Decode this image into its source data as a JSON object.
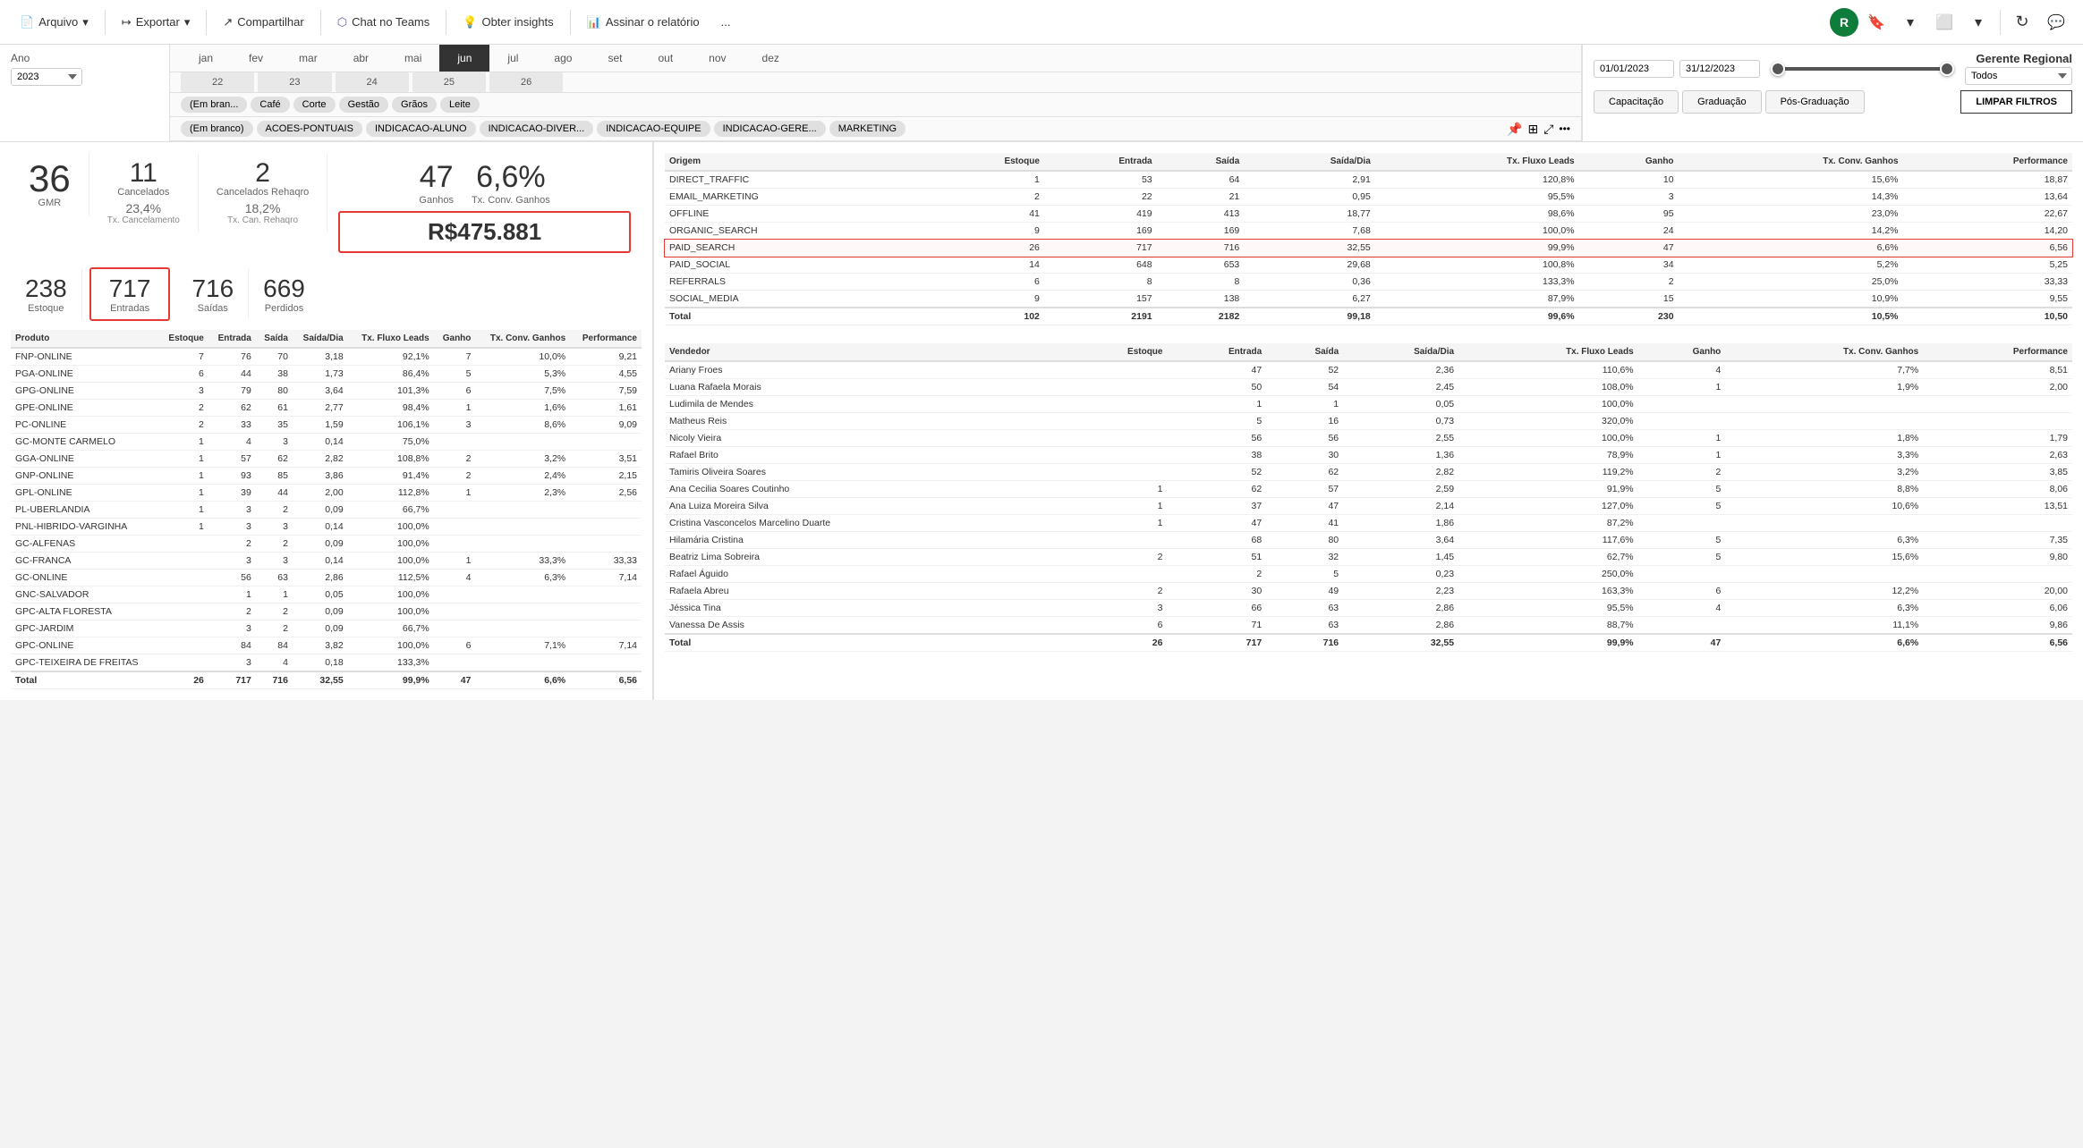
{
  "toolbar": {
    "arquivo_label": "Arquivo",
    "exportar_label": "Exportar",
    "compartilhar_label": "Compartilhar",
    "chat_label": "Chat no Teams",
    "insights_label": "Obter insights",
    "assinar_label": "Assinar o relatório",
    "more_label": "..."
  },
  "header": {
    "year_label": "Ano",
    "year_value": "2023",
    "date_start": "01/01/2023",
    "date_end": "31/12/2023",
    "regional_label": "Gerente Regional",
    "regional_value": "Todos"
  },
  "months": [
    "jan",
    "fev",
    "mar",
    "abr",
    "mai",
    "jun",
    "jul",
    "ago",
    "set",
    "out",
    "nov",
    "dez"
  ],
  "active_month": "jun",
  "weeks": [
    "22",
    "23",
    "24",
    "25",
    "26"
  ],
  "categories": [
    "(Em bran...",
    "Café",
    "Corte",
    "Gestão",
    "Grãos",
    "Leite"
  ],
  "subcategories": [
    "(Em branco)",
    "ACOES-PONTUAIS",
    "INDICACAO-ALUNO",
    "INDICACAO-DIVER...",
    "INDICACAO-EQUIPE",
    "INDICACAO-GERE...",
    "MARKETING"
  ],
  "education_tabs": [
    "Capacitação",
    "Graduação",
    "Pós-Graduação"
  ],
  "clear_btn": "LIMPAR FILTROS",
  "kpis": {
    "gmr_value": "36",
    "gmr_label": "GMR",
    "cancelados_value": "11",
    "cancelados_label": "Cancelados",
    "cancelados_rehaqro_value": "2",
    "cancelados_rehaqro_label": "Cancelados Rehaqro",
    "estoque_value": "238",
    "estoque_label": "Estoque",
    "tx_cancelamento_value": "23,4%",
    "tx_cancelamento_label": "Tx. Cancelamento",
    "tx_can_rehaqro_value": "18,2%",
    "tx_can_rehaqro_label": "Tx. Can. Rehaqro",
    "entradas_value": "717",
    "entradas_label": "Entradas",
    "saidas_value": "716",
    "saidas_label": "Saídas",
    "perdidos_value": "669",
    "perdidos_label": "Perdidos",
    "ganhos_value": "47",
    "ganhos_label": "Ganhos",
    "tx_conv_value": "6,6%",
    "tx_conv_label": "Tx. Conv. Ganhos",
    "revenue_value": "R$475.881"
  },
  "product_table": {
    "columns": [
      "Produto",
      "Estoque",
      "Entrada",
      "Saída",
      "Saída/Dia",
      "Tx. Fluxo Leads",
      "Ganho",
      "Tx. Conv. Ganhos",
      "Performance"
    ],
    "rows": [
      [
        "FNP-ONLINE",
        "7",
        "76",
        "70",
        "3,18",
        "92,1%",
        "7",
        "10,0%",
        "9,21"
      ],
      [
        "PGA-ONLINE",
        "6",
        "44",
        "38",
        "1,73",
        "86,4%",
        "5",
        "5,3%",
        "4,55"
      ],
      [
        "GPG-ONLINE",
        "3",
        "79",
        "80",
        "3,64",
        "101,3%",
        "6",
        "7,5%",
        "7,59"
      ],
      [
        "GPE-ONLINE",
        "2",
        "62",
        "61",
        "2,77",
        "98,4%",
        "1",
        "1,6%",
        "1,61"
      ],
      [
        "PC-ONLINE",
        "2",
        "33",
        "35",
        "1,59",
        "106,1%",
        "3",
        "8,6%",
        "9,09"
      ],
      [
        "GC-MONTE CARMELO",
        "1",
        "4",
        "3",
        "0,14",
        "75,0%",
        "",
        "",
        ""
      ],
      [
        "GGA-ONLINE",
        "1",
        "57",
        "62",
        "2,82",
        "108,8%",
        "2",
        "3,2%",
        "3,51"
      ],
      [
        "GNP-ONLINE",
        "1",
        "93",
        "85",
        "3,86",
        "91,4%",
        "2",
        "2,4%",
        "2,15"
      ],
      [
        "GPL-ONLINE",
        "1",
        "39",
        "44",
        "2,00",
        "112,8%",
        "1",
        "2,3%",
        "2,56"
      ],
      [
        "PL-UBERLANDIA",
        "1",
        "3",
        "2",
        "0,09",
        "66,7%",
        "",
        "",
        ""
      ],
      [
        "PNL-HIBRIDO-VARGINHA",
        "1",
        "3",
        "3",
        "0,14",
        "100,0%",
        "",
        "",
        ""
      ],
      [
        "GC-ALFENAS",
        "",
        "2",
        "2",
        "0,09",
        "100,0%",
        "",
        "",
        ""
      ],
      [
        "GC-FRANCA",
        "",
        "3",
        "3",
        "0,14",
        "100,0%",
        "1",
        "33,3%",
        "33,33"
      ],
      [
        "GC-ONLINE",
        "",
        "56",
        "63",
        "2,86",
        "112,5%",
        "4",
        "6,3%",
        "7,14"
      ],
      [
        "GNC-SALVADOR",
        "",
        "1",
        "1",
        "0,05",
        "100,0%",
        "",
        "",
        ""
      ],
      [
        "GPC-ALTA FLORESTA",
        "",
        "2",
        "2",
        "0,09",
        "100,0%",
        "",
        "",
        ""
      ],
      [
        "GPC-JARDIM",
        "",
        "3",
        "2",
        "0,09",
        "66,7%",
        "",
        "",
        ""
      ],
      [
        "GPC-ONLINE",
        "",
        "84",
        "84",
        "3,82",
        "100,0%",
        "6",
        "7,1%",
        "7,14"
      ],
      [
        "GPC-TEIXEIRA DE FREITAS",
        "",
        "3",
        "4",
        "0,18",
        "133,3%",
        "",
        "",
        ""
      ]
    ],
    "total": [
      "Total",
      "26",
      "717",
      "716",
      "32,55",
      "99,9%",
      "47",
      "6,6%",
      "6,56"
    ]
  },
  "origem_table": {
    "columns": [
      "Origem",
      "Estoque",
      "Entrada",
      "Saída",
      "Saída/Dia",
      "Tx. Fluxo Leads",
      "Ganho",
      "Tx. Conv. Ganhos",
      "Performance"
    ],
    "rows": [
      [
        "DIRECT_TRAFFIC",
        "1",
        "53",
        "64",
        "2,91",
        "120,8%",
        "10",
        "15,6%",
        "18,87"
      ],
      [
        "EMAIL_MARKETING",
        "2",
        "22",
        "21",
        "0,95",
        "95,5%",
        "3",
        "14,3%",
        "13,64"
      ],
      [
        "OFFLINE",
        "41",
        "419",
        "413",
        "18,77",
        "98,6%",
        "95",
        "23,0%",
        "22,67"
      ],
      [
        "ORGANIC_SEARCH",
        "9",
        "169",
        "169",
        "7,68",
        "100,0%",
        "24",
        "14,2%",
        "14,20"
      ],
      [
        "PAID_SEARCH",
        "26",
        "717",
        "716",
        "32,55",
        "99,9%",
        "47",
        "6,6%",
        "6,56"
      ],
      [
        "PAID_SOCIAL",
        "14",
        "648",
        "653",
        "29,68",
        "100,8%",
        "34",
        "5,2%",
        "5,25"
      ],
      [
        "REFERRALS",
        "6",
        "8",
        "8",
        "0,36",
        "133,3%",
        "2",
        "25,0%",
        "33,33"
      ],
      [
        "SOCIAL_MEDIA",
        "9",
        "157",
        "138",
        "6,27",
        "87,9%",
        "15",
        "10,9%",
        "9,55"
      ]
    ],
    "total": [
      "Total",
      "102",
      "2191",
      "2182",
      "99,18",
      "99,6%",
      "230",
      "10,5%",
      "10,50"
    ]
  },
  "vendedor_table": {
    "columns": [
      "Vendedor",
      "Estoque",
      "Entrada",
      "Saída",
      "Saída/Dia",
      "Tx. Fluxo Leads",
      "Ganho",
      "Tx. Conv. Ganhos",
      "Performance"
    ],
    "rows": [
      [
        "Ariany Froes",
        "",
        "47",
        "52",
        "2,36",
        "110,6%",
        "4",
        "7,7%",
        "8,51"
      ],
      [
        "Luana Rafaela Morais",
        "",
        "50",
        "54",
        "2,45",
        "108,0%",
        "1",
        "1,9%",
        "2,00"
      ],
      [
        "Ludimila de Mendes",
        "",
        "1",
        "1",
        "0,05",
        "100,0%",
        "",
        "",
        ""
      ],
      [
        "Matheus Reis",
        "",
        "5",
        "16",
        "0,73",
        "320,0%",
        "",
        "",
        ""
      ],
      [
        "Nicoly Vieira",
        "",
        "56",
        "56",
        "2,55",
        "100,0%",
        "1",
        "1,8%",
        "1,79"
      ],
      [
        "Rafael Brito",
        "",
        "38",
        "30",
        "1,36",
        "78,9%",
        "1",
        "3,3%",
        "2,63"
      ],
      [
        "Tamiris Oliveira Soares",
        "",
        "52",
        "62",
        "2,82",
        "119,2%",
        "2",
        "3,2%",
        "3,85"
      ],
      [
        "Ana Cecilia Soares Coutinho",
        "1",
        "62",
        "57",
        "2,59",
        "91,9%",
        "5",
        "8,8%",
        "8,06"
      ],
      [
        "Ana Luiza Moreira Silva",
        "1",
        "37",
        "47",
        "2,14",
        "127,0%",
        "5",
        "10,6%",
        "13,51"
      ],
      [
        "Cristina Vasconcelos Marcelino Duarte",
        "1",
        "47",
        "41",
        "1,86",
        "87,2%",
        "",
        "",
        ""
      ],
      [
        "Hilamária Cristina",
        "",
        "68",
        "80",
        "3,64",
        "117,6%",
        "5",
        "6,3%",
        "7,35"
      ],
      [
        "Beatriz Lima Sobreira",
        "2",
        "51",
        "32",
        "1,45",
        "62,7%",
        "5",
        "15,6%",
        "9,80"
      ],
      [
        "Rafael Águido",
        "",
        "2",
        "5",
        "0,23",
        "250,0%",
        "",
        "",
        ""
      ],
      [
        "Rafaela Abreu",
        "2",
        "30",
        "49",
        "2,23",
        "163,3%",
        "6",
        "12,2%",
        "20,00"
      ],
      [
        "Jéssica Tina",
        "3",
        "66",
        "63",
        "2,86",
        "95,5%",
        "4",
        "6,3%",
        "6,06"
      ],
      [
        "Vanessa De Assis",
        "6",
        "71",
        "63",
        "2,86",
        "88,7%",
        "",
        "11,1%",
        "9,86"
      ]
    ],
    "total": [
      "Total",
      "26",
      "717",
      "716",
      "32,55",
      "99,9%",
      "47",
      "6,6%",
      "6,56"
    ]
  }
}
